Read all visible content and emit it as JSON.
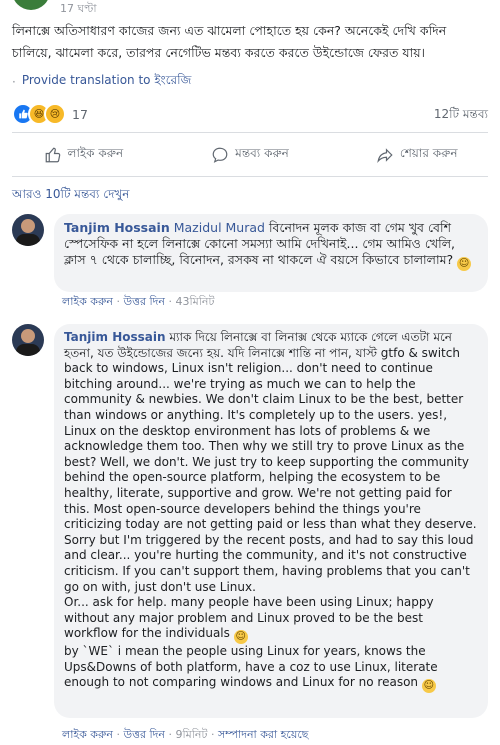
{
  "post": {
    "time": "17 ঘণ্টা",
    "text": "লিনাক্সে অতিসাধারণ কাজের জন্য এত ঝামেলা পোহাতে হয় কেন? অনেকেই দেখি কদিন চালিয়ে, ঝামেলা করে, তারপর নেগেটিভ মন্তব্য করতে করতে উইন্ডোজে ফেরত যায়।",
    "translate_label": "Provide translation to ইংরেজি",
    "reaction_count": "17",
    "comment_count": "12টি মন্তব্য"
  },
  "actions": {
    "like": "লাইক করুন",
    "comment": "মন্তব্য করুন",
    "share": "শেয়ার করুন"
  },
  "more_comments": "আরও 10টি মন্তব্য দেখুন",
  "comments": [
    {
      "author": "Tanjim Hossain",
      "tagged": "Mazidul Murad",
      "text": "বিনোদন মূলক কাজ বা গেম খুব বেশি স্পেসেফিক না হলে লিনাক্সে কোনো সমস্যা আমি দেখিনাই... গেম আমিও খেলি, ক্লাস ৭ থেকে চালাচ্ছি, বিনোদন, রসকষ না থাকলে ঐ বয়সে কিভাবে চালালাম?",
      "like": "লাইক করুন",
      "reply": "উত্তর দিন",
      "time": "43মিনিট"
    },
    {
      "author": "Tanjim Hossain",
      "text_lines": [
        "ম্যাক দিয়ে লিনাক্সে বা লিনাক্স থেকে ম্যাকে গেলে এতটা মনে হতনা, যত উইন্ডোজের জন্যে হয়. যদি লিনাক্সে শান্তি না পান, যাস্ট gtfo & switch back to windows, Linux isn't religion... don't need to continue bitching around... we're trying as much we can to help the community & newbies. We don't claim Linux to be the best, better than windows or anything. It's completely up to the users. yes!, Linux on the desktop environment has lots of problems & we acknowledge them too. Then why we still try to prove Linux as the best? Well, we don't. We just try to keep supporting the community behind the open-source platform, helping the ecosystem to be healthy, literate, supportive and grow. We're not getting paid for this. Most open-source developers behind the things you're criticizing today are not getting paid or less than what they deserve.",
        "Sorry but I'm triggered by the recent posts, and had to say this loud and clear... you're hurting the community, and it's not constructive criticism. If you can't support them, having problems that you can't go on with, just don't use Linux.",
        "Or... ask for help. many people have been using Linux; happy without any major problem and Linux proved to be the best workflow for the individuals",
        "by `WE` i mean the people using Linux for years, knows the Ups&Downs of both platform, have a coz to use Linux, literate enough to not comparing windows and Linux for no reason"
      ],
      "like": "লাইক করুন",
      "reply": "উত্তর দিন",
      "time": "9মিনিট",
      "edited": "সম্পাদনা করা হয়েছে"
    }
  ],
  "colors": {
    "link": "#385898",
    "muted": "#90949c",
    "bubble": "#f2f3f5",
    "like_blue": "#1877f2"
  },
  "icons": [
    "thumbs-up-icon",
    "comment-bubble-icon",
    "share-arrow-icon",
    "smile-emoji-icon"
  ]
}
